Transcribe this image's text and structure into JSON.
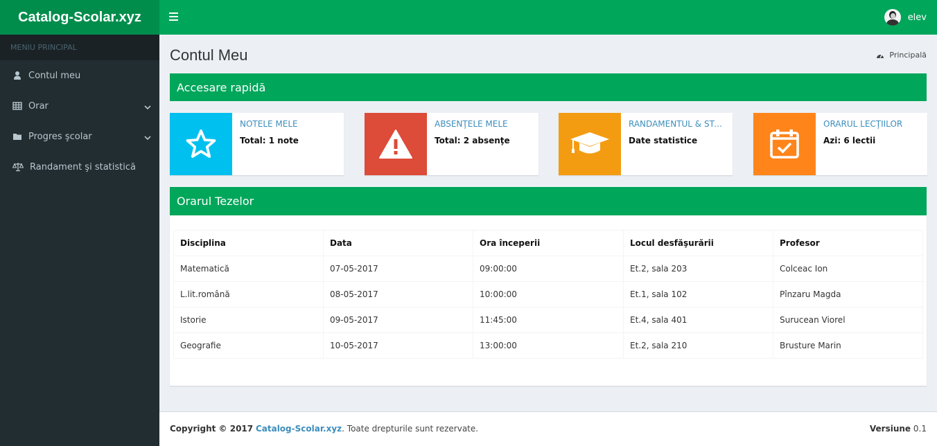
{
  "brand": {
    "logo_text": "Catalog-Scolar.xyz",
    "color": "#008d4c"
  },
  "topbar": {
    "toggle_icon": "menu-icon",
    "user_name": "elev",
    "color": "#00a65a"
  },
  "sidebar": {
    "header": "MENIU PRINCIPAL",
    "items": [
      {
        "label": "Contul meu",
        "icon": "user-icon",
        "has_submenu": false
      },
      {
        "label": "Orar",
        "icon": "table-icon",
        "has_submenu": true
      },
      {
        "label": "Progres şcolar",
        "icon": "folder-icon",
        "has_submenu": true
      },
      {
        "label": "Randament şi statistică",
        "icon": "balance-scale-icon",
        "has_submenu": false
      }
    ]
  },
  "page": {
    "title": "Contul Meu",
    "breadcrumb": "Principală"
  },
  "quick_access": {
    "title": "Accesare rapidă",
    "cards": [
      {
        "title": "NOTELE MELE",
        "value": "Total: 1 note",
        "color": "#00c0ef",
        "icon": "star-icon"
      },
      {
        "title": "ABSENŢELE MELE",
        "value": "Total: 2 absenţe",
        "color": "#dd4b39",
        "icon": "warning-icon"
      },
      {
        "title": "RANDAMENTUL & STATISTICĂ",
        "value": "Date statistice",
        "color": "#f39c12",
        "icon": "graduation-cap-icon"
      },
      {
        "title": "ORARUL LECŢIILOR",
        "value": "Azi: 6 lectii",
        "color": "#ff851b",
        "icon": "calendar-check-icon"
      }
    ]
  },
  "theses": {
    "title": "Orarul Tezelor",
    "columns": [
      "Disciplina",
      "Data",
      "Ora începerii",
      "Locul desfăşurării",
      "Profesor"
    ],
    "rows": [
      [
        "Matematică",
        "07-05-2017",
        "09:00:00",
        "Et.2, sala 203",
        "Colceac Ion"
      ],
      [
        "L.lit.română",
        "08-05-2017",
        "10:00:00",
        "Et.1, sala 102",
        "Pînzaru Magda"
      ],
      [
        "Istorie",
        "09-05-2017",
        "11:45:00",
        "Et.4, sala 401",
        "Surucean Viorel"
      ],
      [
        "Geografie",
        "10-05-2017",
        "13:00:00",
        "Et.2, sala 210",
        "Brusture Marin"
      ]
    ]
  },
  "footer": {
    "copyright_prefix": "Copyright © 2017",
    "site_link": "Catalog-Scolar.xyz",
    "rights": ". Toate drepturile sunt rezervate.",
    "version_label": "Versiune",
    "version": "0.1"
  }
}
